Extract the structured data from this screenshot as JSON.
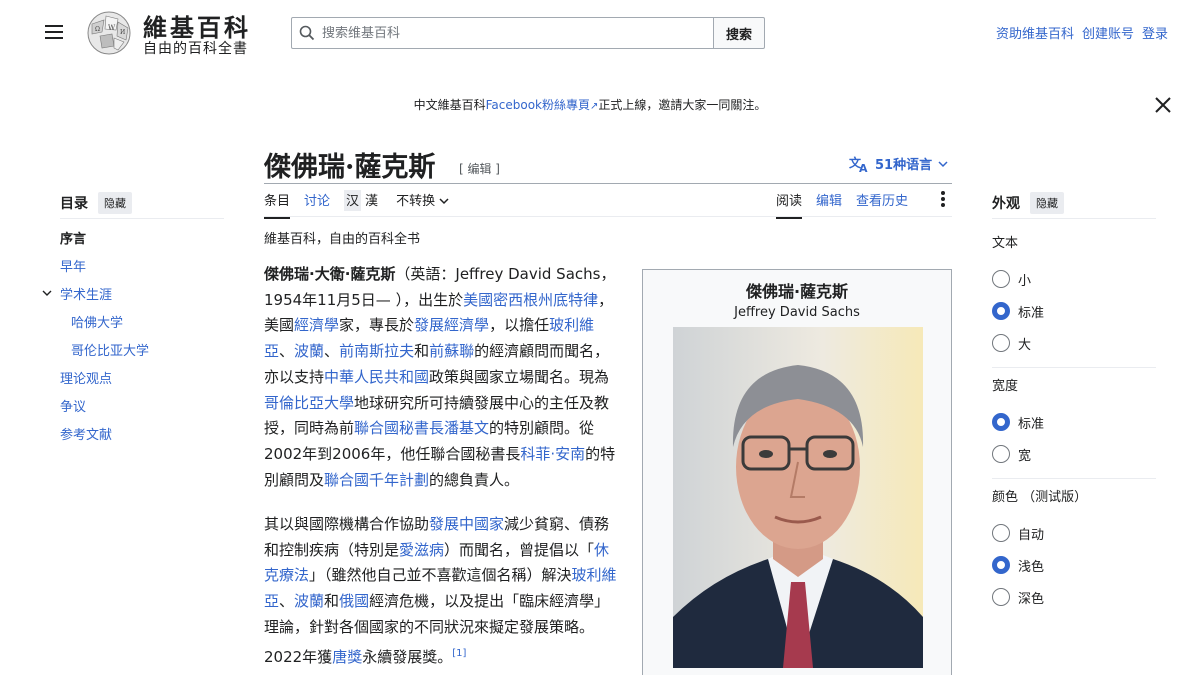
{
  "header": {
    "logo_title": "維基百科",
    "logo_tagline": "自由的百科全書",
    "search_placeholder": "搜索维基百科",
    "search_button": "搜索",
    "user_links": [
      "资助维基百科",
      "创建账号",
      "登录"
    ]
  },
  "banner": {
    "prefix": "中文維基百科",
    "link": "Facebook粉絲專頁",
    "suffix": "正式上線，邀請大家一同關注。"
  },
  "article": {
    "title": "傑佛瑞·薩克斯",
    "edit_label": "[ 编辑 ]",
    "languages": "51种语言",
    "tabs_left": [
      "条目",
      "讨论"
    ],
    "variant": [
      "汉",
      "漢"
    ],
    "variant_menu": "不转换",
    "tabs_right": [
      "阅读",
      "编辑",
      "查看历史"
    ],
    "tagline": "維基百科，自由的百科全书"
  },
  "toc": {
    "title": "目录",
    "hide": "隐藏",
    "items": [
      "序言",
      "早年",
      "学术生涯",
      "哈佛大学",
      "哥伦比亚大学",
      "理论观点",
      "争议",
      "参考文献"
    ]
  },
  "appearance": {
    "title": "外观",
    "hide": "隐藏",
    "text_label": "文本",
    "text_options": [
      "小",
      "标准",
      "大"
    ],
    "width_label": "宽度",
    "width_options": [
      "标准",
      "宽"
    ],
    "color_label": "颜色 （测试版）",
    "color_options": [
      "自动",
      "浅色",
      "深色"
    ]
  },
  "infobox": {
    "name_zh": "傑佛瑞·薩克斯",
    "name_en": "Jeffrey David Sachs"
  },
  "paragraphs": {
    "p1": {
      "bold_name": "傑佛瑞·大衛·薩克斯",
      "t1": "（英語：Jeffrey David Sachs，1954年11月5日— ），出生於",
      "l1": "美國密西根州底特律",
      "t2": "，美國",
      "l2": "經濟學",
      "t3": "家，專長於",
      "l3": "發展經濟學",
      "t4": "，以擔任",
      "l4": "玻利維亞",
      "t5": "、",
      "l5": "波蘭",
      "t6": "、",
      "l6": "前南斯拉夫",
      "t7": "和",
      "l7": "前蘇聯",
      "t8": "的經濟顧問而聞名，亦以支持",
      "l8": "中華人民共和國",
      "t9": "政策與國家立場聞名。現為",
      "l9": "哥倫比亞大學",
      "t10": "地球研究所可持續發展中心的主任及教授，同時為前",
      "l10": "聯合國秘書長潘基文",
      "t11": "的特別顧問。從2002年到2006年，他任聯合國秘書長",
      "l11": "科菲·安南",
      "t12": "的特別顧問及",
      "l12": "聯合國千年計劃",
      "t13": "的總負責人。"
    },
    "p2": {
      "t1": "其以與國際機構合作協助",
      "l1": "發展中國家",
      "t2": "減少貧窮、債務和控制疾病（特別是",
      "l2": "愛滋病",
      "t3": "）而聞名，曾提倡以「",
      "l3": "休克療法",
      "t4": "」（雖然他自己並不喜歡這個名稱）解決",
      "l4": "玻利維亞",
      "t5": "、",
      "l5": "波蘭",
      "t6": "和",
      "l6": "俄國",
      "t7": "經濟危機，以及提出「臨床經濟學」理論，針對各個國家的不同狀況來擬定發展策略。2022年獲",
      "l7": "唐獎",
      "t8": "永續發展獎。",
      "ref": "[1]"
    }
  },
  "colors": {
    "link": "#3366cc",
    "text": "#202122",
    "radio_on": "#3366cc"
  }
}
